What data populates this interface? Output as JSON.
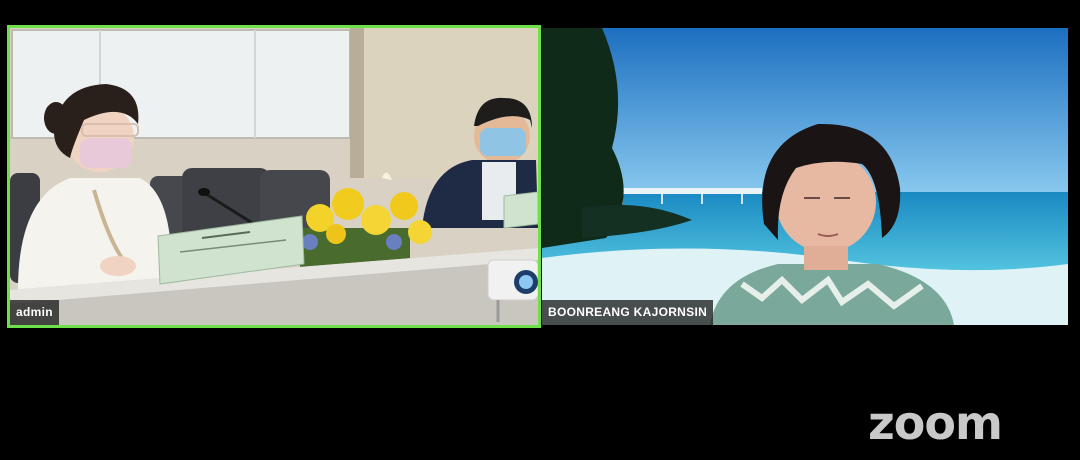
{
  "meeting": {
    "participants": [
      {
        "name": "admin",
        "speaking": true
      },
      {
        "name": "BOONREANG KAJORNSIN",
        "speaking": false
      }
    ],
    "logo_text": "zoom"
  },
  "colors": {
    "background": "#000000",
    "active_speaker_border": "#6ee04a",
    "name_tag_bg": "#1e1e1e",
    "logo": "#c9c9c9"
  }
}
